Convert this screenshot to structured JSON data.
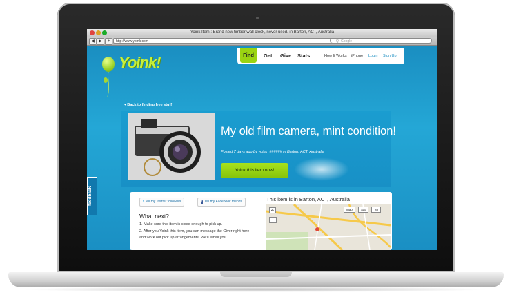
{
  "browser": {
    "title": "Yoink Item : Brand new timber wall clock, never used. in Barton, ACT, Australia",
    "url": "http://www.yoink.com",
    "search_placeholder": "Q- Google",
    "back": "◀",
    "forward": "▶",
    "add": "+"
  },
  "site": {
    "logo": "Yoink!",
    "nav": {
      "find": "Find",
      "get": "Get",
      "give": "Give",
      "stats": "Stats"
    },
    "nav_links": {
      "how_it_works": "How It Works",
      "iphone": "iPhone",
      "login": "Login",
      "signup": "Sign Up"
    }
  },
  "item": {
    "back_link": "Back to finding free stuff",
    "title": "My old film camera, mint condition!",
    "meta": "Posted 7 days ago by yoink_###### in Barton, ACT, Australia",
    "button": "Yoink this item now!"
  },
  "feedback": "feedback",
  "share": {
    "twitter": "Tell my Twitter followers",
    "facebook": "Tell my Facebook friends"
  },
  "next": {
    "heading": "What next?",
    "steps": [
      "1.  Make sure this item is close enough to pick up.",
      "2.  After you Yoink this item, you can message the Giver right here and work out pick up arrangements. We'll email you"
    ]
  },
  "map": {
    "heading": "This item is in Barton, ACT, Australia",
    "buttons": [
      "Map",
      "Sat",
      "Ter"
    ]
  },
  "colors": {
    "page_blue": "#1c97c9",
    "accent_green": "#9ad412",
    "logo_green": "#c8f03a"
  }
}
